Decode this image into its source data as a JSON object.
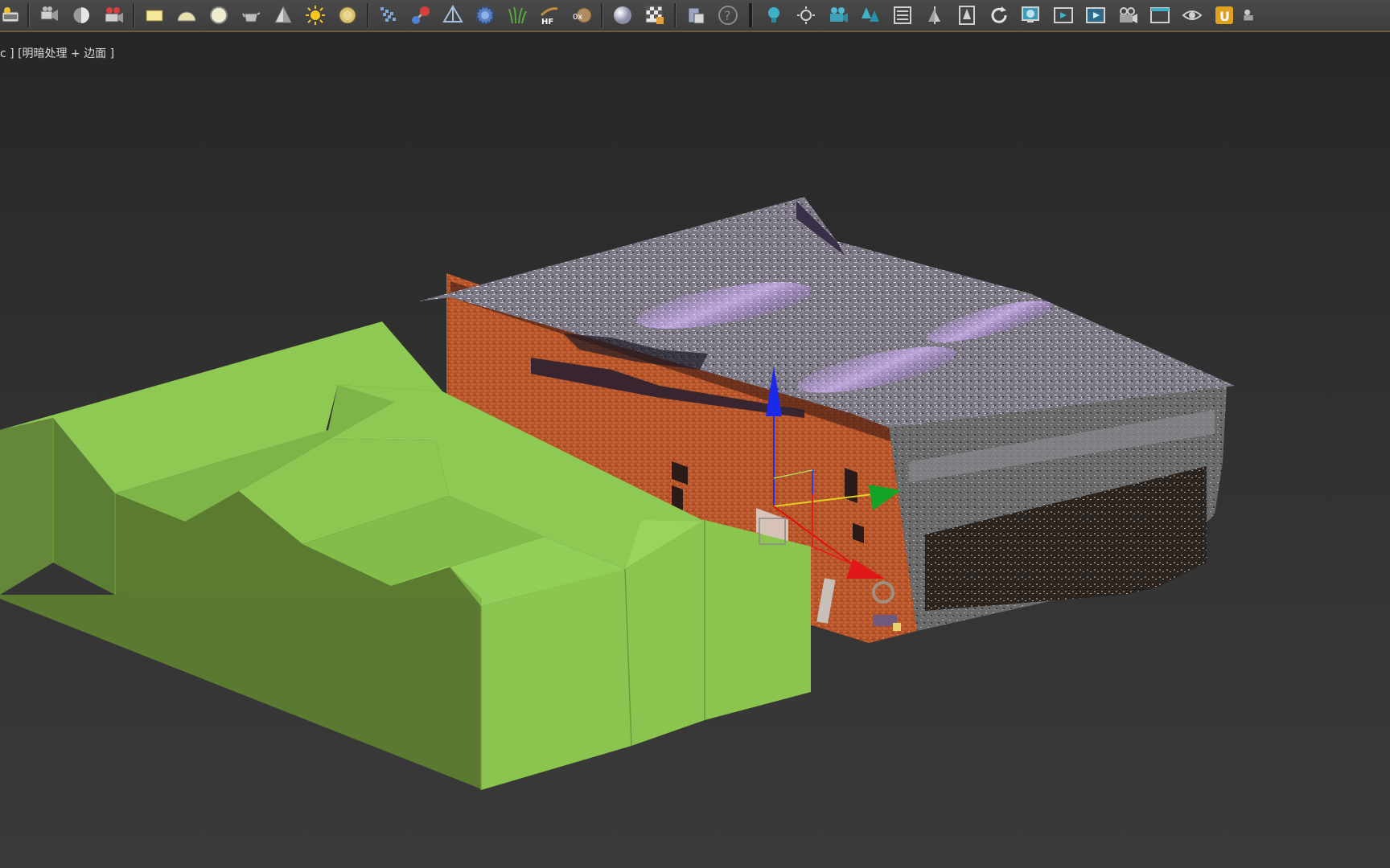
{
  "viewport": {
    "label_prefix": "c ]",
    "label_shading": "[明暗处理 + 边面 ]"
  },
  "toolbar": {
    "icons_left": [
      "slate-icon",
      "camera-pan-icon",
      "half-sphere-icon",
      "movie-camera-icon"
    ],
    "icons_primitives": [
      "plane-icon",
      "dome-icon",
      "sphere-icon",
      "teapot-icon",
      "cone-icon",
      "sun-icon",
      "disk-icon"
    ],
    "icons_tools": [
      "grid-icon",
      "molecule-icon",
      "pyramid-icon",
      "gear-sphere-icon",
      "grass-icon",
      "hair-fur-icon",
      "ox-icon"
    ],
    "icons_material": [
      "material-sphere-icon",
      "checker-icon",
      "clipboard-icon",
      "help-icon"
    ],
    "icons_right": [
      "light-bulb-icon",
      "sun-outline-icon",
      "camera-group-icon",
      "trees-icon",
      "list-icon",
      "sail-icon",
      "cypress-icon",
      "refresh-icon",
      "display-icon",
      "frame-icon",
      "render-frame-icon",
      "render-camera-icon",
      "window-icon",
      "eye-icon",
      "u-icon",
      "tree-camera-icon"
    ],
    "help_glyph": "?",
    "hf_text": "HF",
    "ox_text": "0x",
    "u_text": "U"
  },
  "colors": {
    "toolbar_bg": "#414141",
    "viewport_bg": "#2e2e2e",
    "proxy_light": "#8fce55",
    "proxy_dark": "#5a7b30",
    "brick": "#b6562a",
    "roof": "#8b8794",
    "gizmo_x": "#e01010",
    "gizmo_y": "#10a020",
    "gizmo_z": "#1030e0"
  }
}
